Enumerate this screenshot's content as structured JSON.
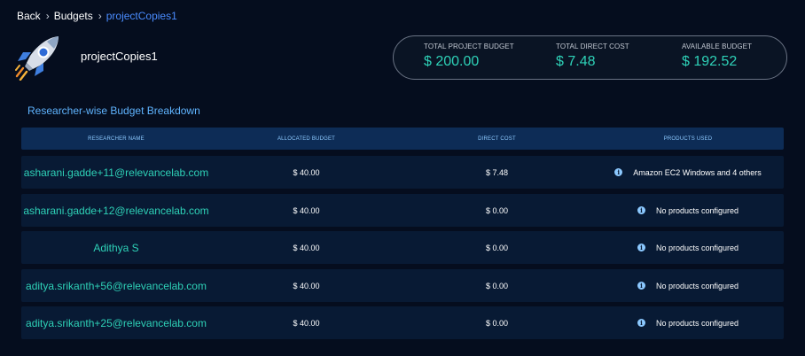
{
  "breadcrumb": {
    "back": "Back",
    "budgets": "Budgets",
    "current": "projectCopies1",
    "separator": "›"
  },
  "project": {
    "name": "projectCopies1",
    "icon": "rocket-icon"
  },
  "summary": {
    "total_budget_label": "TOTAL PROJECT BUDGET",
    "total_budget_value": "$ 200.00",
    "direct_cost_label": "TOTAL DIRECT COST",
    "direct_cost_value": "$ 7.48",
    "available_label": "AVAILABLE BUDGET",
    "available_value": "$ 192.52"
  },
  "section_title": "Researcher-wise Budget Breakdown",
  "table": {
    "columns": [
      "RESEARCHER NAME",
      "ALLOCATED BUDGET",
      "DIRECT COST",
      "PRODUCTS USED"
    ],
    "rows": [
      {
        "name": "asharani.gadde+11@relevancelab.com",
        "allocated": "$ 40.00",
        "cost": "$ 7.48",
        "products": "Amazon EC2 Windows and 4 others"
      },
      {
        "name": "asharani.gadde+12@relevancelab.com",
        "allocated": "$ 40.00",
        "cost": "$ 0.00",
        "products": "No products configured"
      },
      {
        "name": "Adithya S",
        "allocated": "$ 40.00",
        "cost": "$ 0.00",
        "products": "No products configured"
      },
      {
        "name": "aditya.srikanth+56@relevancelab.com",
        "allocated": "$ 40.00",
        "cost": "$ 0.00",
        "products": "No products configured"
      },
      {
        "name": "aditya.srikanth+25@relevancelab.com",
        "allocated": "$ 40.00",
        "cost": "$ 0.00",
        "products": "No products configured"
      }
    ]
  },
  "colors": {
    "background": "#050d1e",
    "accent_teal": "#2ed1b7",
    "link_blue": "#4a8cff",
    "header_bg": "#0d2c56",
    "row_bg": "#081a34"
  },
  "icons": {
    "info": "info-icon"
  }
}
